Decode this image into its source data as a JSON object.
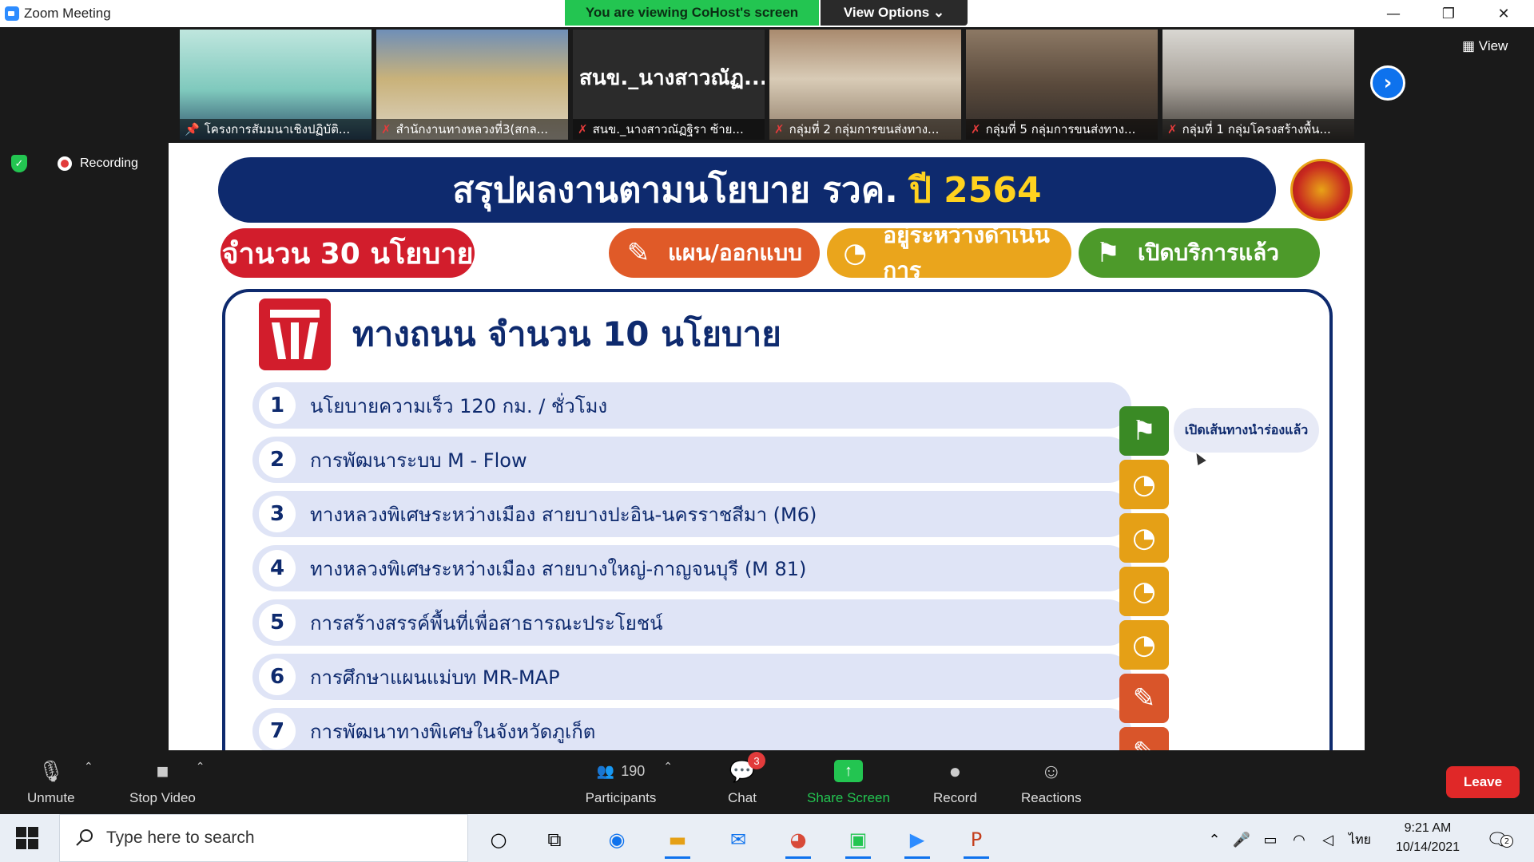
{
  "window": {
    "title": "Zoom Meeting",
    "viewing_banner": "You are viewing CoHost's screen",
    "view_options": "View Options ⌄"
  },
  "window_controls": {
    "minimize": "—",
    "restore": "❐",
    "close": "✕"
  },
  "participants_strip": [
    {
      "caption": "โครงการสัมมนาเชิงปฏิบัติ...",
      "pinned": true
    },
    {
      "caption": "สำนักงานทางหลวงที่3(สกล..."
    },
    {
      "caption": "สนข._นางสาวณัฏฐิรา ซ้าย...",
      "big_name": "สนข._นางสาวณัฏ..."
    },
    {
      "caption": "กลุ่มที่ 2 กลุ่มการขนส่งทาง..."
    },
    {
      "caption": "กลุ่มที่ 5 กลุ่มการขนส่งทาง..."
    },
    {
      "caption": "กลุ่มที่ 1 กลุ่มโครงสร้างพื้น..."
    }
  ],
  "view_button": "View",
  "recording_label": "Recording",
  "slide": {
    "title": "สรุปผลงานตามนโยบาย รวค.",
    "year": "ปี 2564",
    "count_label": "จำนวน 30 นโยบาย",
    "legend": {
      "plan": "แผน/ออกแบบ",
      "progress": "อยู่ระหว่างดำเนินการ",
      "open": "เปิดบริการแล้ว"
    },
    "section_title": "ทางถนน จำนวน 10 นโยบาย",
    "rows": [
      {
        "num": "1",
        "label": "นโยบายความเร็ว 120 กม. / ชั่วโมง",
        "status": "open"
      },
      {
        "num": "2",
        "label": "การพัฒนาระบบ M - Flow",
        "status": "progress"
      },
      {
        "num": "3",
        "label": "ทางหลวงพิเศษระหว่างเมือง สายบางปะอิน-นครราชสีมา (M6)",
        "status": "progress"
      },
      {
        "num": "4",
        "label": "ทางหลวงพิเศษระหว่างเมือง สายบางใหญ่-กาญจนบุรี (M 81)",
        "status": "progress"
      },
      {
        "num": "5",
        "label": "การสร้างสรรค์พื้นที่เพื่อสาธารณะประโยชน์",
        "status": "progress"
      },
      {
        "num": "6",
        "label": "การศึกษาแผนแม่บท MR-MAP",
        "status": "plan"
      },
      {
        "num": "7",
        "label": "การพัฒนาทางพิเศษในจังหวัดภูเก็ต",
        "status": "plan"
      }
    ],
    "row1_note": "เปิดเส้นทางนำร่องแล้ว"
  },
  "toolbar": {
    "unmute": "Unmute",
    "stop_video": "Stop Video",
    "participants": "Participants",
    "participants_count": "190",
    "chat": "Chat",
    "chat_badge": "3",
    "share_screen": "Share Screen",
    "record": "Record",
    "reactions": "Reactions",
    "leave": "Leave"
  },
  "taskbar": {
    "search_placeholder": "Type here to search",
    "language": "ไทย",
    "time": "9:21 AM",
    "date": "10/14/2021",
    "notification_count": "2"
  },
  "colors": {
    "navy": "#0e2a6e",
    "red": "#d21d2c",
    "orange": "#e05a28",
    "yellow": "#eaa51c",
    "green": "#4d9a2a",
    "zoom_green": "#23c551",
    "zoom_blue": "#0e72ed"
  }
}
